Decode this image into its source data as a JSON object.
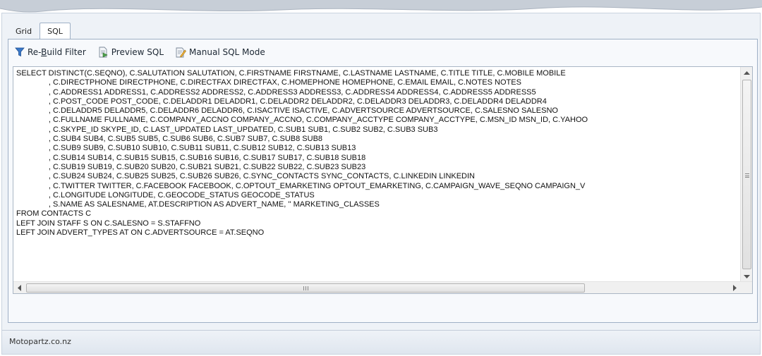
{
  "tabs": [
    {
      "label": "Grid",
      "active": false
    },
    {
      "label": "SQL",
      "active": true
    }
  ],
  "toolbar": {
    "rebuild_pre": "Re-",
    "rebuild_mnemonic": "B",
    "rebuild_post": "uild Filter",
    "preview_label": "Preview SQL",
    "manual_label": "Manual SQL Mode"
  },
  "editor": {
    "sql": "SELECT DISTINCT(C.SEQNO), C.SALUTATION SALUTATION, C.FIRSTNAME FIRSTNAME, C.LASTNAME LASTNAME, C.TITLE TITLE, C.MOBILE MOBILE\n               , C.DIRECTPHONE DIRECTPHONE, C.DIRECTFAX DIRECTFAX, C.HOMEPHONE HOMEPHONE, C.EMAIL EMAIL, C.NOTES NOTES\n               , C.ADDRESS1 ADDRESS1, C.ADDRESS2 ADDRESS2, C.ADDRESS3 ADDRESS3, C.ADDRESS4 ADDRESS4, C.ADDRESS5 ADDRESS5\n               , C.POST_CODE POST_CODE, C.DELADDR1 DELADDR1, C.DELADDR2 DELADDR2, C.DELADDR3 DELADDR3, C.DELADDR4 DELADDR4\n               , C.DELADDR5 DELADDR5, C.DELADDR6 DELADDR6, C.ISACTIVE ISACTIVE, C.ADVERTSOURCE ADVERTSOURCE, C.SALESNO SALESNO\n               , C.FULLNAME FULLNAME, C.COMPANY_ACCNO COMPANY_ACCNO, C.COMPANY_ACCTYPE COMPANY_ACCTYPE, C.MSN_ID MSN_ID, C.YAHOO\n               , C.SKYPE_ID SKYPE_ID, C.LAST_UPDATED LAST_UPDATED, C.SUB1 SUB1, C.SUB2 SUB2, C.SUB3 SUB3\n               , C.SUB4 SUB4, C.SUB5 SUB5, C.SUB6 SUB6, C.SUB7 SUB7, C.SUB8 SUB8\n               , C.SUB9 SUB9, C.SUB10 SUB10, C.SUB11 SUB11, C.SUB12 SUB12, C.SUB13 SUB13\n               , C.SUB14 SUB14, C.SUB15 SUB15, C.SUB16 SUB16, C.SUB17 SUB17, C.SUB18 SUB18\n               , C.SUB19 SUB19, C.SUB20 SUB20, C.SUB21 SUB21, C.SUB22 SUB22, C.SUB23 SUB23\n               , C.SUB24 SUB24, C.SUB25 SUB25, C.SUB26 SUB26, C.SYNC_CONTACTS SYNC_CONTACTS, C.LINKEDIN LINKEDIN\n               , C.TWITTER TWITTER, C.FACEBOOK FACEBOOK, C.OPTOUT_EMARKETING OPTOUT_EMARKETING, C.CAMPAIGN_WAVE_SEQNO CAMPAIGN_V\n               , C.LONGITUDE LONGITUDE, C.GEOCODE_STATUS GEOCODE_STATUS\n               , S.NAME AS SALESNAME, AT.DESCRIPTION AS ADVERT_NAME, '' MARKETING_CLASSES\nFROM CONTACTS C\nLEFT JOIN STAFF S ON C.SALESNO = S.STAFFNO\nLEFT JOIN ADVERT_TYPES AT ON C.ADVERTSOURCE = AT.SEQNO"
  },
  "statusbar": {
    "text": "Motopartz.co.nz"
  },
  "icons": {
    "filter": "funnel-icon",
    "preview": "preview-document-icon",
    "manual": "edit-document-icon"
  },
  "colors": {
    "window_bg": "#eef2f7",
    "border": "#9fb0c6",
    "filter_icon": "#3a78c8"
  }
}
